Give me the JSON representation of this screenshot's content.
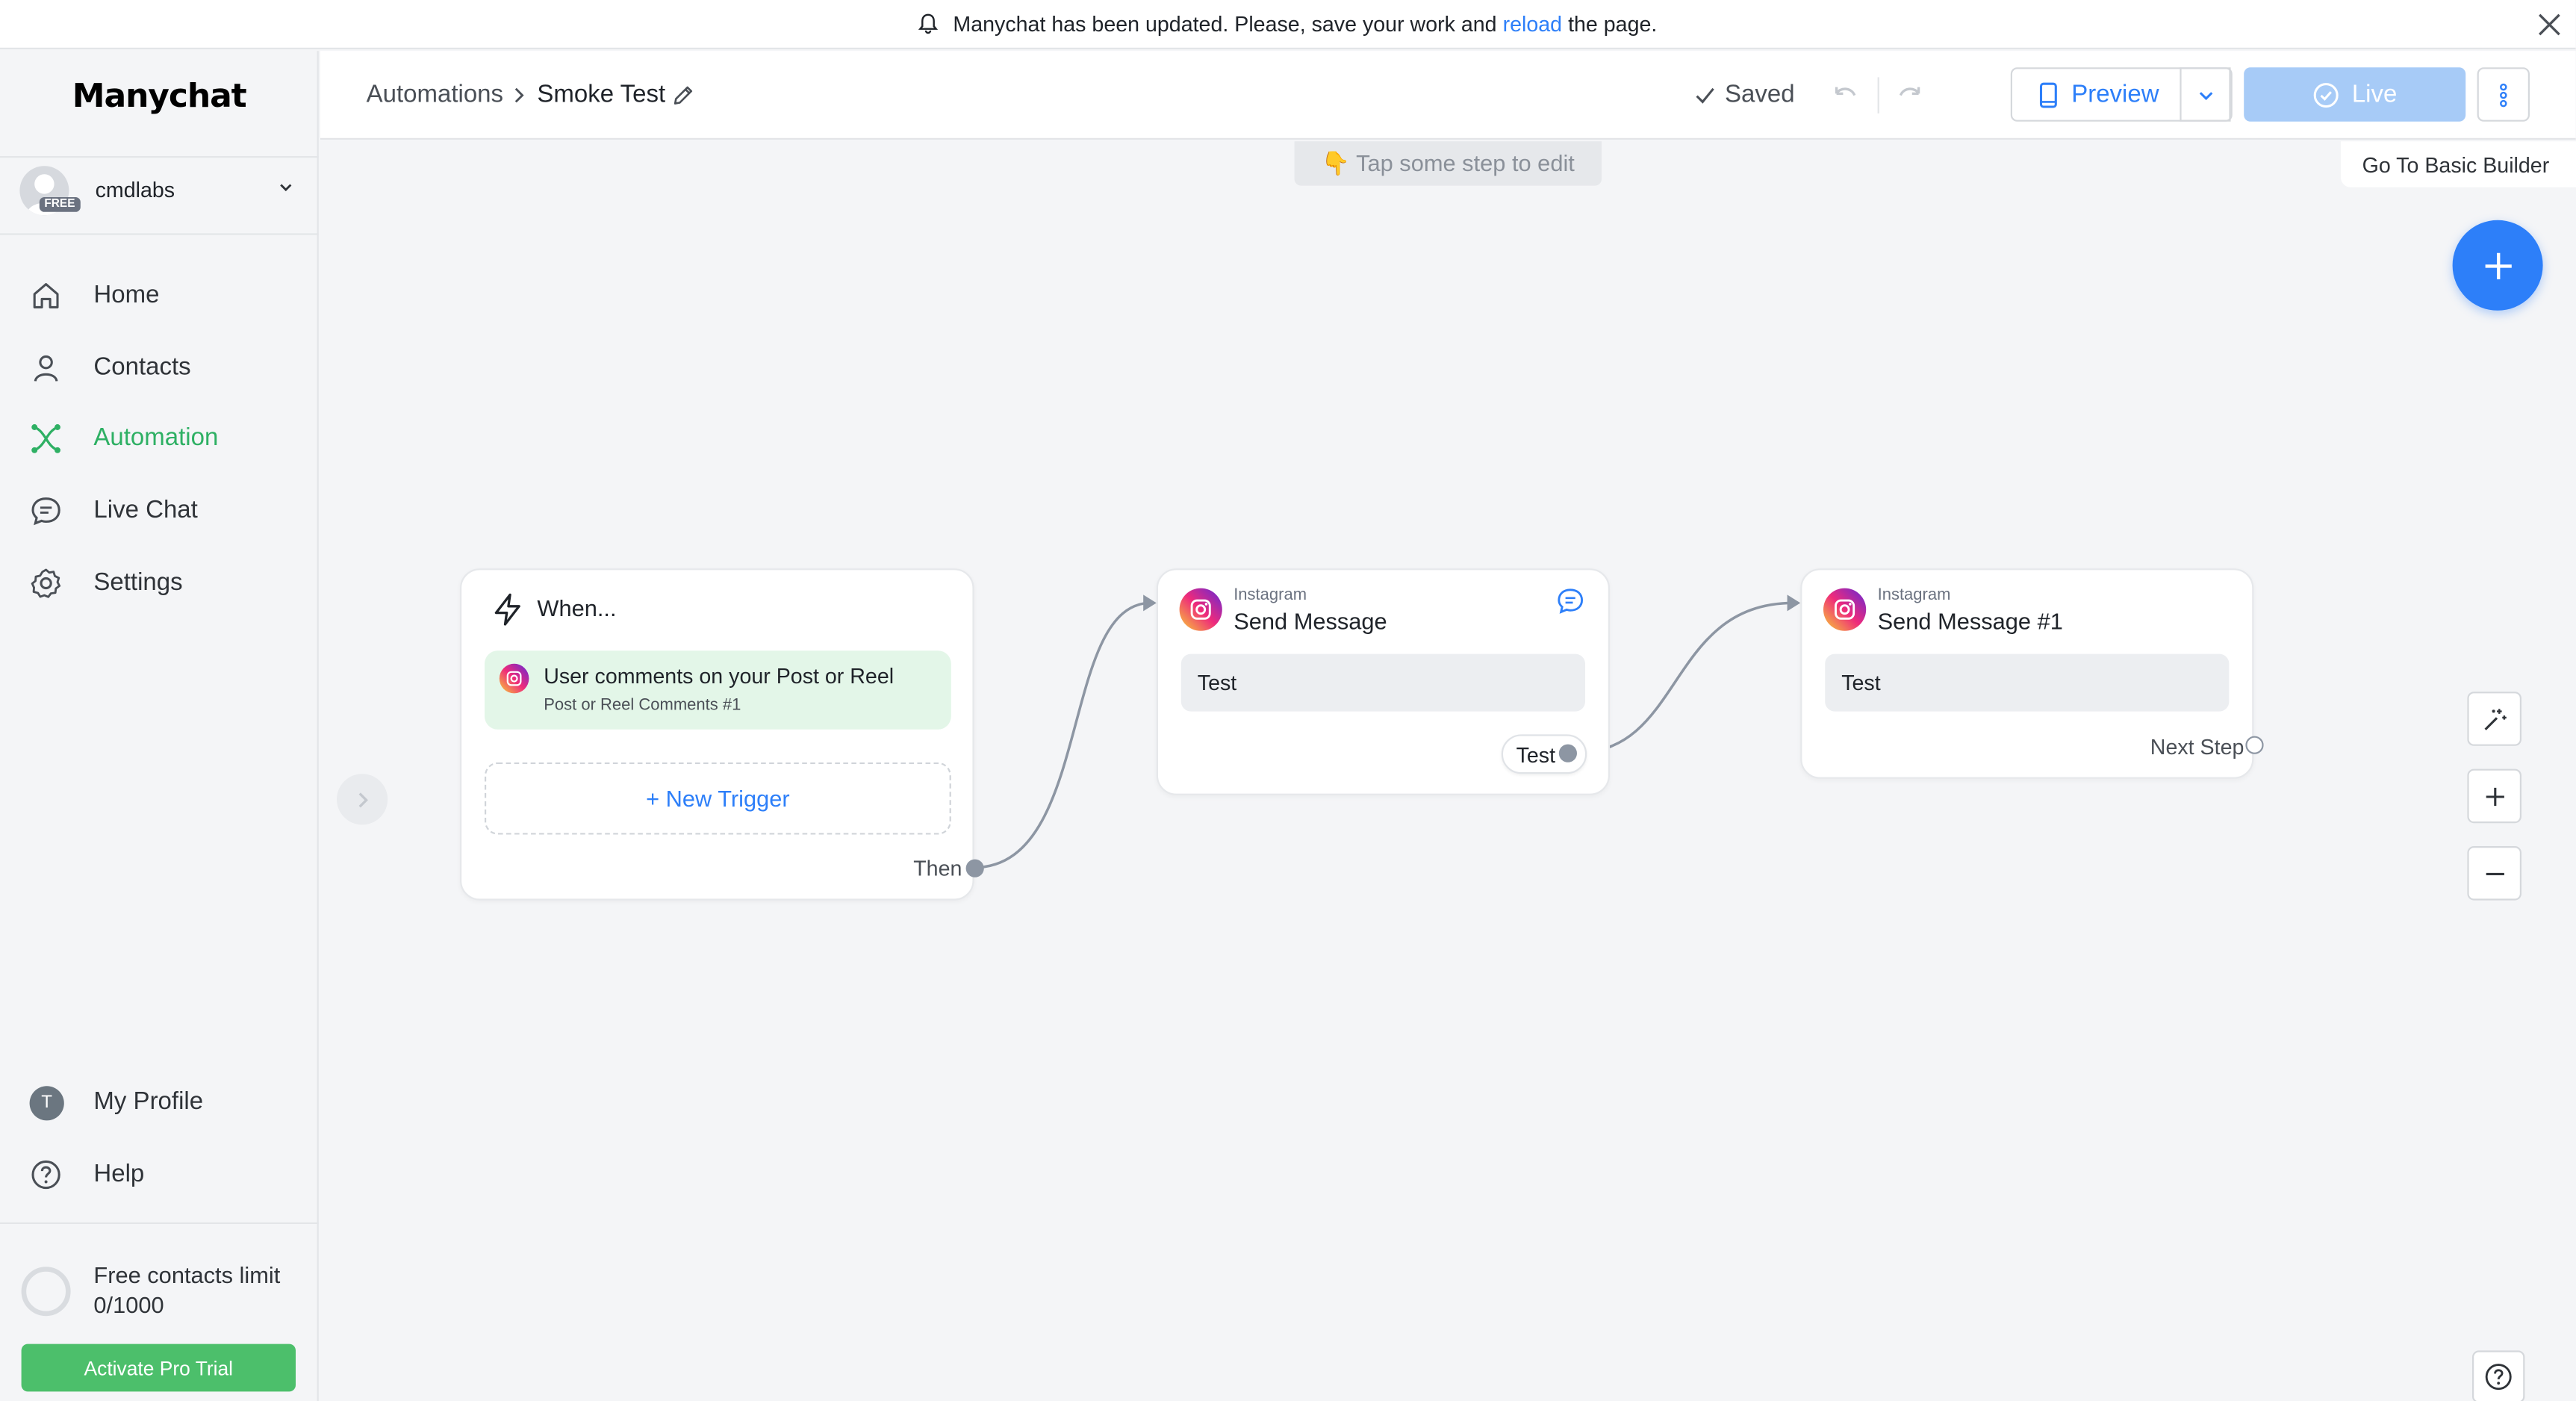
{
  "banner": {
    "text_before": "Manychat has been updated. Please, save your work and",
    "link": "reload",
    "text_after": "the page."
  },
  "sidebar": {
    "logo": "Manychat",
    "account": {
      "name": "cmdlabs",
      "plan_badge": "FREE"
    },
    "nav": [
      {
        "label": "Home",
        "icon": "home-icon"
      },
      {
        "label": "Contacts",
        "icon": "person-icon"
      },
      {
        "label": "Automation",
        "icon": "automation-icon",
        "active": true
      },
      {
        "label": "Live Chat",
        "icon": "chat-icon"
      },
      {
        "label": "Settings",
        "icon": "gear-icon"
      }
    ],
    "bottom_nav": [
      {
        "label": "My Profile",
        "avatar_letter": "T"
      },
      {
        "label": "Help",
        "icon": "help-icon"
      }
    ],
    "limit": {
      "label": "Free contacts limit",
      "value": "0/1000",
      "button": "Activate Pro Trial"
    }
  },
  "header": {
    "breadcrumb_root": "Automations",
    "flow_name": "Smoke Test",
    "status": "Saved",
    "preview_label": "Preview",
    "live_label": "Live"
  },
  "canvas": {
    "hint": "👇 Tap some step to edit",
    "basic_builder": "Go To Basic Builder",
    "trigger_node": {
      "title": "When...",
      "trigger": "User comments on your Post or Reel",
      "trigger_sub": "Post or Reel Comments #1",
      "new_trigger": "+ New Trigger",
      "then": "Then"
    },
    "nodes": [
      {
        "platform": "Instagram",
        "title": "Send Message",
        "message": "Test",
        "button": "Test"
      },
      {
        "platform": "Instagram",
        "title": "Send Message #1",
        "message": "Test",
        "next": "Next Step"
      }
    ]
  },
  "colors": {
    "accent": "#2d7ff9",
    "active_nav": "#2eb064",
    "live_button": "#a7cbf7",
    "pro_button": "#4cbf6b"
  }
}
